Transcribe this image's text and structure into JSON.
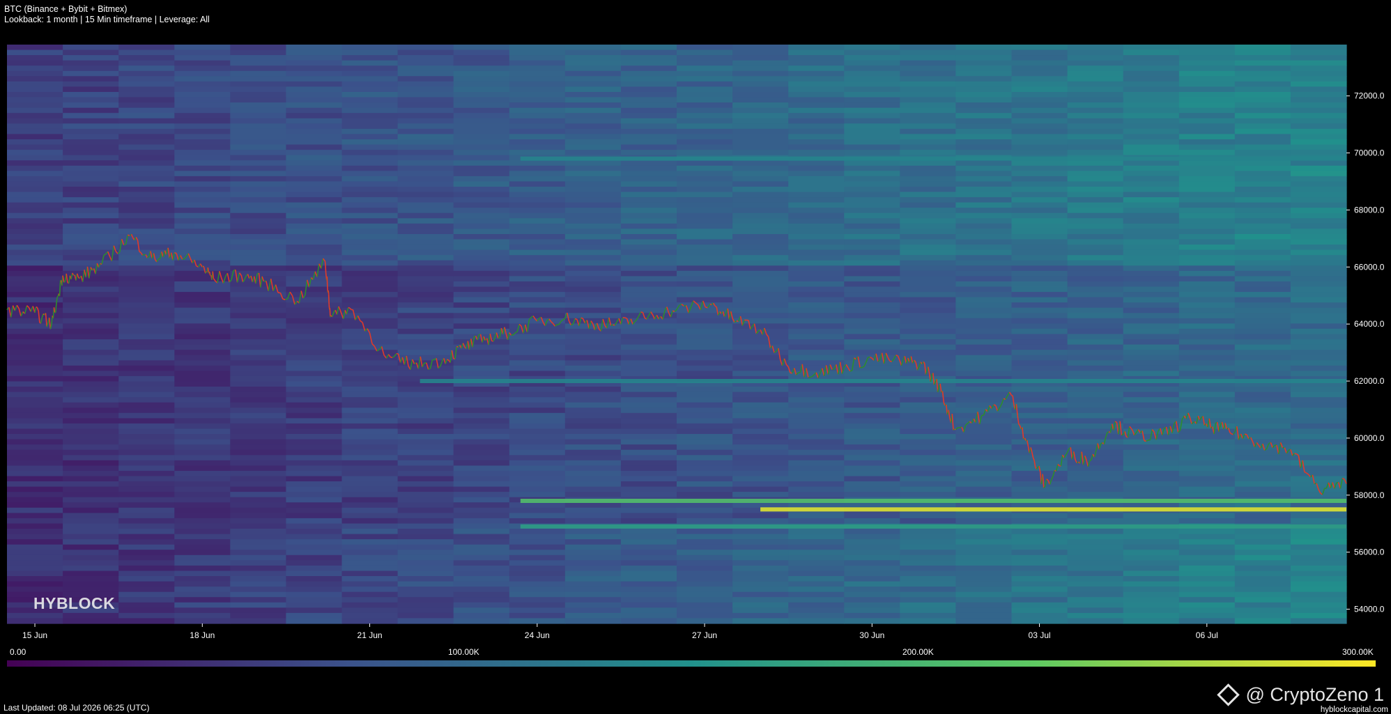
{
  "header": {
    "title": "BTC (Binance + Bybit + Bitmex)",
    "subtitle": "Lookback: 1 month | 15 Min timeframe | Leverage: All"
  },
  "footer": {
    "last_updated": "Last Updated: 08 Jul 2026 06:25 (UTC)",
    "brand": "HYBLOCK",
    "credit": "@ CryptoZeno 1",
    "site": "hyblockcapital.com"
  },
  "colors": {
    "background": "#000000",
    "candle_up": "#2e8b2e",
    "candle_down": "#e03a2a",
    "colormap": [
      "#440154",
      "#3b528b",
      "#21918c",
      "#5ec962",
      "#fde725"
    ]
  },
  "chart_data": {
    "type": "heatmap",
    "title": "BTC (Binance + Bybit + Bitmex)",
    "x_ticks": [
      "15 Jun",
      "18 Jun",
      "21 Jun",
      "24 Jun",
      "27 Jun",
      "30 Jun",
      "03 Jul",
      "06 Jul"
    ],
    "x_range_days": [
      0,
      24
    ],
    "x_tick_days": [
      0.5,
      3.5,
      6.5,
      9.5,
      12.5,
      15.5,
      18.5,
      21.5
    ],
    "y_ticks": [
      "72000.0",
      "70000.0",
      "68000.0",
      "66000.0",
      "64000.0",
      "62000.0",
      "60000.0",
      "58000.0",
      "56000.0",
      "54000.0"
    ],
    "y_range": [
      53500,
      73800
    ],
    "colorbar": {
      "ticks": [
        "0.00",
        "100.00K",
        "200.00K",
        "300.00K"
      ],
      "range": [
        0,
        300000
      ]
    },
    "price_path": [
      [
        0.0,
        64500
      ],
      [
        0.5,
        64400
      ],
      [
        0.8,
        64000
      ],
      [
        1.0,
        65700
      ],
      [
        1.3,
        65600
      ],
      [
        1.7,
        66100
      ],
      [
        2.2,
        67100
      ],
      [
        2.6,
        66300
      ],
      [
        3.0,
        66500
      ],
      [
        3.5,
        66000
      ],
      [
        3.7,
        65600
      ],
      [
        4.2,
        65700
      ],
      [
        4.6,
        65500
      ],
      [
        5.2,
        64800
      ],
      [
        5.7,
        66200
      ],
      [
        5.8,
        64300
      ],
      [
        6.2,
        64500
      ],
      [
        6.8,
        62800
      ],
      [
        7.3,
        62600
      ],
      [
        7.8,
        62700
      ],
      [
        8.2,
        63200
      ],
      [
        8.6,
        63500
      ],
      [
        9.0,
        63700
      ],
      [
        9.5,
        64100
      ],
      [
        10.0,
        64200
      ],
      [
        10.5,
        64000
      ],
      [
        11.0,
        64000
      ],
      [
        11.5,
        64300
      ],
      [
        12.0,
        64500
      ],
      [
        12.6,
        64700
      ],
      [
        13.0,
        64200
      ],
      [
        13.5,
        63800
      ],
      [
        14.0,
        62500
      ],
      [
        14.5,
        62300
      ],
      [
        15.0,
        62500
      ],
      [
        15.5,
        62800
      ],
      [
        16.0,
        62700
      ],
      [
        16.4,
        62600
      ],
      [
        16.7,
        61800
      ],
      [
        17.0,
        60300
      ],
      [
        17.5,
        60800
      ],
      [
        18.0,
        61500
      ],
      [
        18.3,
        59700
      ],
      [
        18.6,
        58300
      ],
      [
        19.0,
        59500
      ],
      [
        19.4,
        59200
      ],
      [
        19.8,
        60500
      ],
      [
        20.2,
        60100
      ],
      [
        20.7,
        60100
      ],
      [
        21.2,
        60700
      ],
      [
        21.6,
        60400
      ],
      [
        22.0,
        60200
      ],
      [
        22.5,
        59800
      ],
      [
        23.0,
        59600
      ],
      [
        23.5,
        58200
      ],
      [
        24.0,
        58400
      ]
    ],
    "liquidation_bands": [
      {
        "price": 57500,
        "intensity": 0.95
      },
      {
        "price": 57800,
        "intensity": 0.7
      },
      {
        "price": 69800,
        "intensity": 0.45
      },
      {
        "price": 62000,
        "intensity": 0.45
      },
      {
        "price": 56900,
        "intensity": 0.55
      }
    ]
  }
}
